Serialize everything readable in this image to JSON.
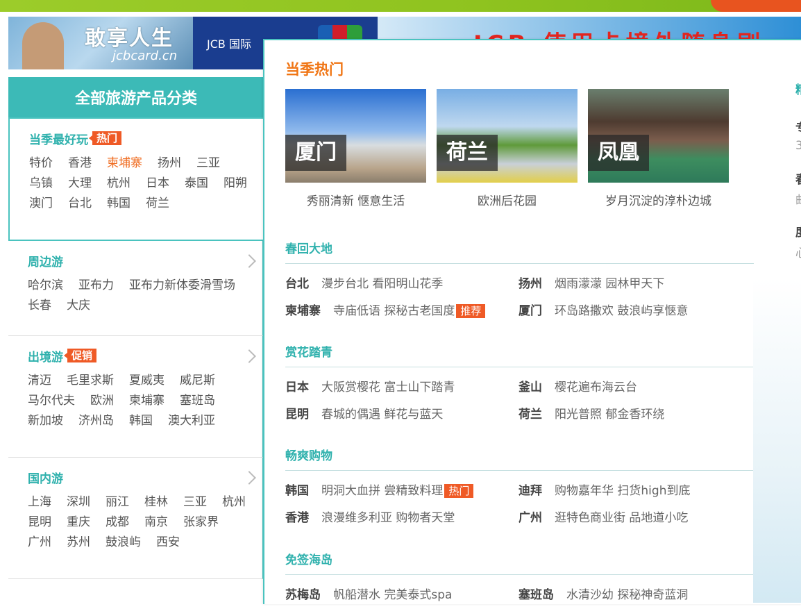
{
  "banner": {
    "slogan": "敢享人生",
    "site": "jcbcard.cn",
    "strip_text": "JCB 国际",
    "headline": "JCB 使用卡境外随身刷 WIFI"
  },
  "sidebar": {
    "header": "全部旅游产品分类",
    "sections": [
      {
        "title": "当季最好玩",
        "tag": "热门",
        "links": [
          "特价",
          "香港",
          "柬埔寨",
          "扬州",
          "三亚",
          "乌镇",
          "大理",
          "杭州",
          "日本",
          "泰国",
          "阳朔",
          "澳门",
          "台北",
          "韩国",
          "荷兰"
        ],
        "highlight": "柬埔寨"
      },
      {
        "title": "周边游",
        "tag": "",
        "links": [
          "哈尔滨",
          "亚布力",
          "亚布力新体委滑雪场",
          "长春",
          "大庆"
        ]
      },
      {
        "title": "出境游",
        "tag": "促销",
        "links": [
          "清迈",
          "毛里求斯",
          "夏威夷",
          "威尼斯",
          "马尔代夫",
          "欧洲",
          "柬埔寨",
          "塞班岛",
          "新加坡",
          "济州岛",
          "韩国",
          "澳大利亚"
        ]
      },
      {
        "title": "国内游",
        "tag": "",
        "links": [
          "上海",
          "深圳",
          "丽江",
          "桂林",
          "三亚",
          "杭州",
          "昆明",
          "重庆",
          "成都",
          "南京",
          "张家界",
          "广州",
          "苏州",
          "鼓浪屿",
          "西安"
        ]
      }
    ]
  },
  "panel": {
    "title": "当季热门",
    "cards": [
      {
        "caption": "厦门",
        "sub": "秀丽清新 惬意生活"
      },
      {
        "caption": "荷兰",
        "sub": "欧洲后花园"
      },
      {
        "caption": "凤凰",
        "sub": "岁月沉淀的淳朴边城"
      }
    ],
    "categories": [
      {
        "title": "春回大地",
        "items": [
          {
            "city": "台北",
            "desc": "漫步台北 看阳明山花季",
            "tag": ""
          },
          {
            "city": "扬州",
            "desc": "烟雨濛濛 园林甲天下",
            "tag": ""
          },
          {
            "city": "柬埔寨",
            "desc": "寺庙低语 探秘古老国度",
            "tag": "推荐"
          },
          {
            "city": "厦门",
            "desc": "环岛路撒欢 鼓浪屿享惬意",
            "tag": ""
          }
        ]
      },
      {
        "title": "赏花踏青",
        "items": [
          {
            "city": "日本",
            "desc": "大阪赏樱花 富士山下踏青",
            "tag": ""
          },
          {
            "city": "釜山",
            "desc": "樱花遍布海云台",
            "tag": ""
          },
          {
            "city": "昆明",
            "desc": "春城的偶遇 鲜花与蓝天",
            "tag": ""
          },
          {
            "city": "荷兰",
            "desc": "阳光普照 郁金香环绕",
            "tag": ""
          }
        ]
      },
      {
        "title": "畅爽购物",
        "items": [
          {
            "city": "韩国",
            "desc": "明洞大血拼 尝精致料理",
            "tag": "热门"
          },
          {
            "city": "迪拜",
            "desc": "购物嘉年华 扫货high到底",
            "tag": ""
          },
          {
            "city": "香港",
            "desc": "浪漫维多利亚 购物者天堂",
            "tag": ""
          },
          {
            "city": "广州",
            "desc": "逛特色商业街 品地道小吃",
            "tag": ""
          }
        ]
      },
      {
        "title": "免签海岛",
        "items": [
          {
            "city": "苏梅岛",
            "desc": "帆船潜水 完美泰式spa",
            "tag": ""
          },
          {
            "city": "塞班岛",
            "desc": "水清沙幼 探秘神奇蓝洞",
            "tag": ""
          }
        ]
      }
    ],
    "right_peek": [
      "精",
      "专",
      "3",
      "春",
      "邮",
      "度",
      "心"
    ]
  },
  "colors": {
    "teal": "#3cbab7",
    "orange": "#f07514",
    "tag_bg": "#ef5a26"
  }
}
